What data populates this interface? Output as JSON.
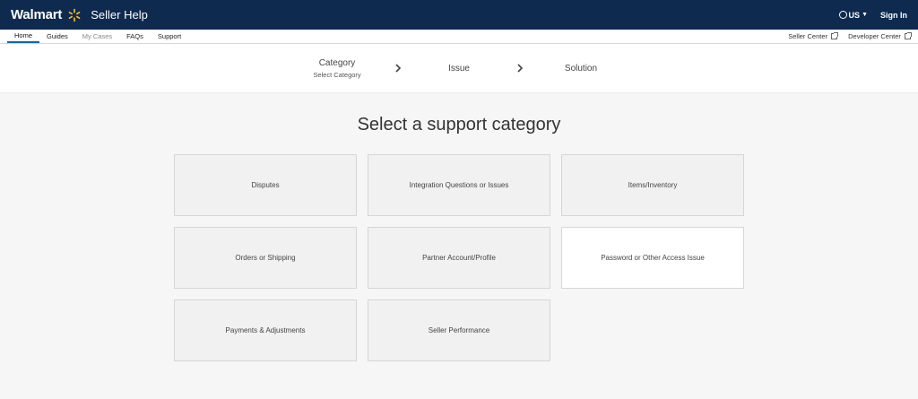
{
  "header": {
    "brand": "Walmart",
    "product": "Seller Help",
    "locale": "US",
    "sign_in": "Sign In"
  },
  "subnav": {
    "items": [
      {
        "label": "Home",
        "state": "active"
      },
      {
        "label": "Guides",
        "state": "normal"
      },
      {
        "label": "My Cases",
        "state": "muted"
      },
      {
        "label": "FAQs",
        "state": "normal"
      },
      {
        "label": "Support",
        "state": "normal"
      }
    ],
    "right_links": [
      "Seller Center",
      "Developer Center"
    ]
  },
  "stepper": {
    "steps": [
      {
        "label": "Category",
        "sub": "Select Category"
      },
      {
        "label": "Issue",
        "sub": ""
      },
      {
        "label": "Solution",
        "sub": ""
      }
    ]
  },
  "main": {
    "title": "Select a support category",
    "categories": [
      "Disputes",
      "Integration Questions or Issues",
      "Items/Inventory",
      "Orders or Shipping",
      "Partner Account/Profile",
      "Password or Other Access Issue",
      "Payments & Adjustments",
      "Seller Performance"
    ]
  },
  "colors": {
    "header_bg": "#0e2a4f",
    "accent": "#0e67b2",
    "spark": "#ffc220"
  }
}
